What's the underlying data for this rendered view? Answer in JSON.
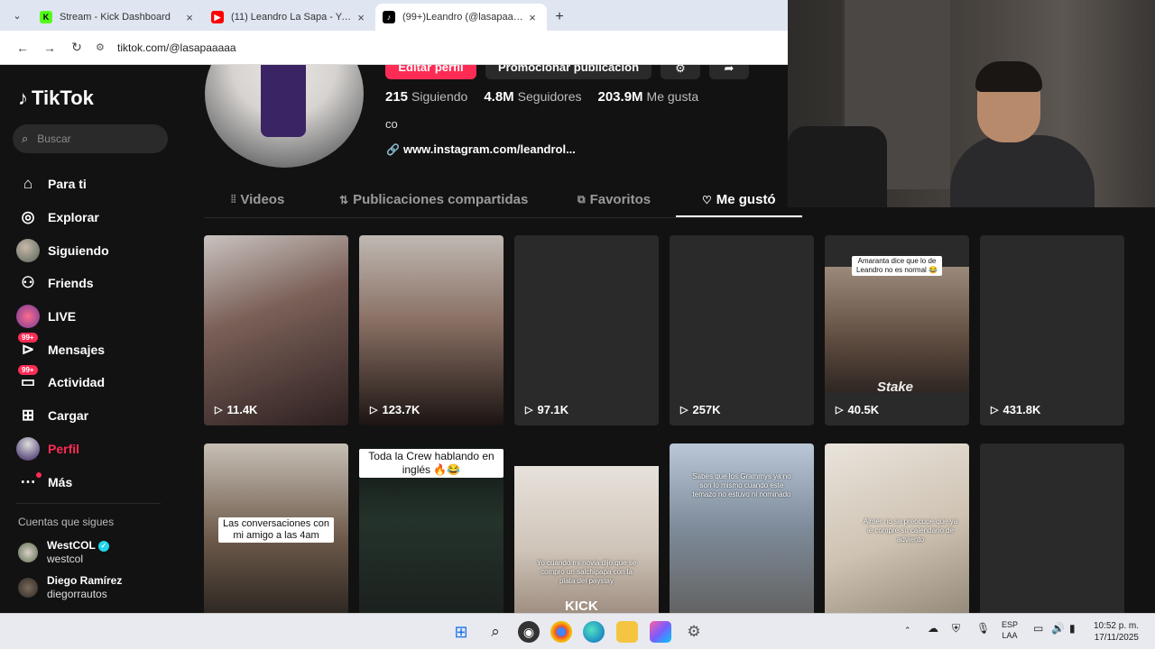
{
  "browser": {
    "tabs": [
      {
        "title": "Stream - Kick Dashboard",
        "favicon": "kick-icon",
        "active": false
      },
      {
        "title": "(11) Leandro La Sapa - YouTube",
        "favicon": "youtube-icon",
        "active": false
      },
      {
        "title": "(99+)Leandro (@lasapaaaaa) | T",
        "favicon": "tiktok-icon",
        "active": true
      }
    ],
    "url": "tiktok.com/@lasapaaaaa"
  },
  "sidebar": {
    "logo": "TikTok",
    "search_placeholder": "Buscar",
    "items": [
      {
        "label": "Para ti",
        "icon": "home-icon"
      },
      {
        "label": "Explorar",
        "icon": "compass-icon"
      },
      {
        "label": "Siguiendo",
        "icon": "following-avatar-icon"
      },
      {
        "label": "Friends",
        "icon": "friends-icon"
      },
      {
        "label": "LIVE",
        "icon": "live-icon"
      },
      {
        "label": "Mensajes",
        "icon": "messages-icon",
        "badge": "99+"
      },
      {
        "label": "Actividad",
        "icon": "activity-icon",
        "badge": "99+"
      },
      {
        "label": "Cargar",
        "icon": "upload-icon"
      },
      {
        "label": "Perfil",
        "icon": "profile-avatar-icon"
      },
      {
        "label": "Más",
        "icon": "more-icon"
      }
    ],
    "following_title": "Cuentas que sigues",
    "accounts": [
      {
        "name": "WestCOL",
        "handle": "westcol",
        "verified": true
      },
      {
        "name": "Diego Ramírez",
        "handle": "diegorrautos"
      }
    ]
  },
  "profile": {
    "edit_button": "Editar perfil",
    "promote_button": "Promocionar publicación",
    "stats": [
      {
        "value": "215",
        "label": "Siguiendo"
      },
      {
        "value": "4.8M",
        "label": "Seguidores"
      },
      {
        "value": "203.9M",
        "label": "Me gusta"
      }
    ],
    "bio": "co",
    "link": "www.instagram.com/leandrol..."
  },
  "profile_tabs": [
    {
      "label": "Videos",
      "icon": "grid-icon"
    },
    {
      "label": "Publicaciones compartidas",
      "icon": "repost-icon"
    },
    {
      "label": "Favoritos",
      "icon": "bookmark-icon"
    },
    {
      "label": "Me gustó",
      "icon": "heart-icon",
      "active": true
    }
  ],
  "videos": [
    {
      "views": "11.4K"
    },
    {
      "views": "123.7K"
    },
    {
      "views": "97.1K"
    },
    {
      "views": "257K"
    },
    {
      "views": "40.5K",
      "caption": "Amaranta dice que lo de Leandro no es normal 😂",
      "watermark": "Stake"
    },
    {
      "views": "431.8K"
    },
    {
      "caption": "Las conversaciones con mi amigo a las 4am"
    },
    {
      "caption": "Toda la Crew hablando en inglés 🔥😂"
    },
    {
      "caption": "Yo cuando mi novia dijo que se compró un salchipapa con la plata del paystay",
      "watermark": "KICK"
    },
    {
      "caption": "Sabes que los Grammys ya no son lo mismo cuando este temazo no estuvo ni nominado"
    },
    {
      "caption": "Aimer no se preocupe que ya le compré su calendario de adviento"
    },
    {}
  ],
  "taskbar": {
    "language": [
      "ESP",
      "LAA"
    ],
    "time": "10:52 p. m.",
    "date": "17/11/2025"
  }
}
